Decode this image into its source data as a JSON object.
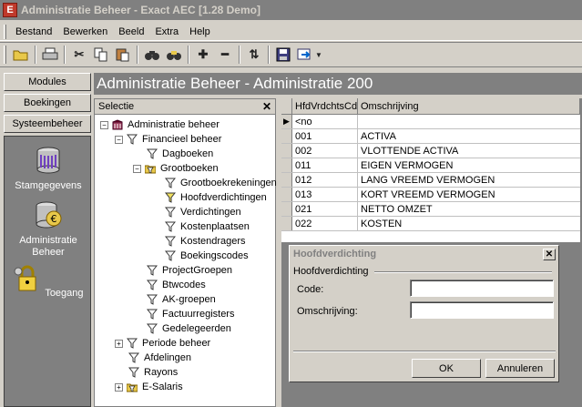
{
  "window": {
    "title": "Administratie Beheer - Exact AEC [1.28 Demo]",
    "logo_letter": "E"
  },
  "menu": {
    "items": [
      "Bestand",
      "Bewerken",
      "Beeld",
      "Extra",
      "Help"
    ]
  },
  "toolbar": {
    "icons": [
      "open-folder-icon",
      "print-icon",
      "cut-icon",
      "copy-icon",
      "paste-icon",
      "find-icon",
      "find-next-icon",
      "add-icon",
      "remove-icon",
      "sort-icon",
      "save-icon",
      "export-icon"
    ]
  },
  "nav": {
    "tabs": [
      "Modules",
      "Boekingen",
      "Systeembeheer"
    ],
    "panel_items": [
      "Stamgegevens",
      "Administratie Beheer",
      "Toegang"
    ]
  },
  "header": {
    "title": "Administratie Beheer - Administratie 200"
  },
  "selectie": {
    "title": "Selectie",
    "tree": [
      {
        "label": "Administratie beheer",
        "level": 0,
        "expander": "−",
        "icon": "building"
      },
      {
        "label": "Financieel beheer",
        "level": 1,
        "expander": "−",
        "icon": "funnel"
      },
      {
        "label": "Dagboeken",
        "level": 2,
        "expander": "",
        "icon": "funnel"
      },
      {
        "label": "Grootboeken",
        "level": 2,
        "expander": "−",
        "icon": "folder-funnel"
      },
      {
        "label": "Grootboekrekeningen",
        "level": 3,
        "expander": "",
        "icon": "funnel"
      },
      {
        "label": "Hoofdverdichtingen",
        "level": 3,
        "expander": "",
        "icon": "funnel-yellow"
      },
      {
        "label": "Verdichtingen",
        "level": 3,
        "expander": "",
        "icon": "funnel"
      },
      {
        "label": "Kostenplaatsen",
        "level": 3,
        "expander": "",
        "icon": "funnel"
      },
      {
        "label": "Kostendragers",
        "level": 3,
        "expander": "",
        "icon": "funnel"
      },
      {
        "label": "Boekingscodes",
        "level": 3,
        "expander": "",
        "icon": "funnel"
      },
      {
        "label": "ProjectGroepen",
        "level": 2,
        "expander": "",
        "icon": "funnel"
      },
      {
        "label": "Btwcodes",
        "level": 2,
        "expander": "",
        "icon": "funnel"
      },
      {
        "label": "AK-groepen",
        "level": 2,
        "expander": "",
        "icon": "funnel"
      },
      {
        "label": "Factuurregisters",
        "level": 2,
        "expander": "",
        "icon": "funnel"
      },
      {
        "label": "Gedelegeerden",
        "level": 2,
        "expander": "",
        "icon": "funnel"
      },
      {
        "label": "Periode beheer",
        "level": 1,
        "expander": "+",
        "icon": "funnel"
      },
      {
        "label": "Afdelingen",
        "level": 1,
        "expander": "",
        "icon": "funnel"
      },
      {
        "label": "Rayons",
        "level": 1,
        "expander": "",
        "icon": "funnel"
      },
      {
        "label": "E-Salaris",
        "level": 1,
        "expander": "+",
        "icon": "folder-funnel"
      }
    ]
  },
  "grid": {
    "columns": [
      "HfdVrdchtsCd",
      "Omschrijving"
    ],
    "rows": [
      {
        "code": "<no",
        "desc": "",
        "current": true
      },
      {
        "code": "001",
        "desc": "ACTIVA",
        "current": false
      },
      {
        "code": "002",
        "desc": "VLOTTENDE ACTIVA",
        "current": false
      },
      {
        "code": "011",
        "desc": "EIGEN VERMOGEN",
        "current": false
      },
      {
        "code": "012",
        "desc": "LANG VREEMD VERMOGEN",
        "current": false
      },
      {
        "code": "013",
        "desc": "KORT VREEMD VERMOGEN",
        "current": false
      },
      {
        "code": "021",
        "desc": "NETTO OMZET",
        "current": false
      },
      {
        "code": "022",
        "desc": "KOSTEN",
        "current": false
      }
    ]
  },
  "dialog": {
    "title": "Hoofdverdichting",
    "group_label": "Hoofdverdichting",
    "code_label": "Code:",
    "code_value": "",
    "desc_label": "Omschrijving:",
    "desc_value": "",
    "ok_label": "OK",
    "cancel_label": "Annuleren"
  }
}
